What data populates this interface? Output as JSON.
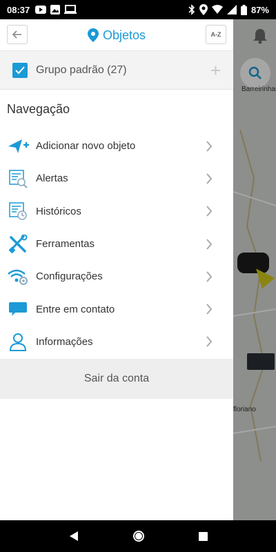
{
  "status_bar": {
    "time": "08:37",
    "battery": "87%"
  },
  "header": {
    "title": "Objetos",
    "sort_label": "A-Z"
  },
  "group": {
    "label": "Grupo padrão (27)",
    "checked": true
  },
  "navigation": {
    "heading": "Navegação",
    "items": [
      {
        "label": "Adicionar novo objeto",
        "icon": "add-object-icon"
      },
      {
        "label": "Alertas",
        "icon": "alerts-icon"
      },
      {
        "label": "Históricos",
        "icon": "history-icon"
      },
      {
        "label": "Ferramentas",
        "icon": "tools-icon"
      },
      {
        "label": "Configurações",
        "icon": "settings-icon"
      },
      {
        "label": "Entre em contato",
        "icon": "chat-icon"
      },
      {
        "label": "Informações",
        "icon": "user-icon"
      }
    ]
  },
  "logout_label": "Sair da conta",
  "map_labels": {
    "top": "Barreirinhas",
    "bottom": "floriano"
  },
  "colors": {
    "accent": "#1b9ad6"
  }
}
